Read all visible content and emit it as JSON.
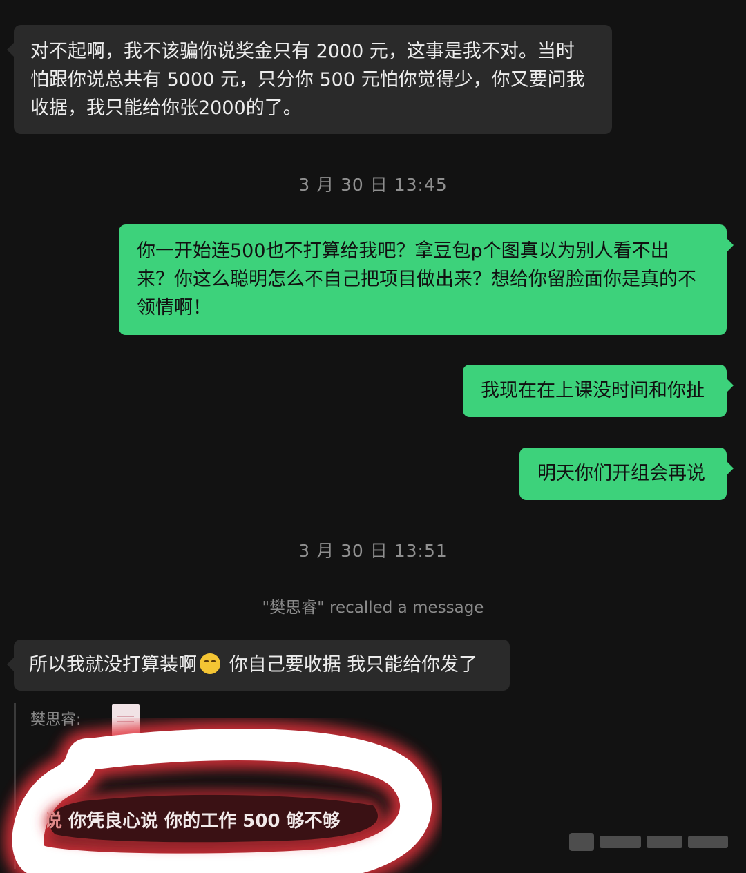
{
  "messages": {
    "m1": {
      "line1": "对不起啊，我不该骗你说奖金只有 2000 元，这事是我不对。当时",
      "line2": "怕跟你说总共有 5000 元，只分你 500 元怕你觉得少，你又要问我",
      "line3": "收据，我只能给你张2000的了。"
    },
    "ts1": "3 月 30 日 13:45",
    "m2": {
      "line1": "你一开始连500也不打算给我吧？拿豆包p个图真以为别人看不出",
      "line2": "来？你这么聪明怎么不自己把项目做出来？想给你留脸面你是真的不",
      "line3": "领情啊！"
    },
    "m3": "我现在在上课没时间和你扯",
    "m4": "明天你们开组会再说",
    "ts2": "3 月 30 日 13:51",
    "recall": "\"樊思睿\" recalled a message",
    "m5": {
      "part1": "所以我就没打算装啊",
      "part2": " 你自己要收据  我只能给你发了",
      "emoji_icon": "facepalm-emoji"
    },
    "quote": {
      "sender": "樊思睿:",
      "text_cut": "说",
      "text": "你凭良心说 你的工作 500 够不够"
    }
  },
  "colors": {
    "background": "#121212",
    "incoming_bubble": "#2a2a2a",
    "outgoing_bubble": "#3dd27b",
    "highlight_mark": "#e0303a"
  }
}
